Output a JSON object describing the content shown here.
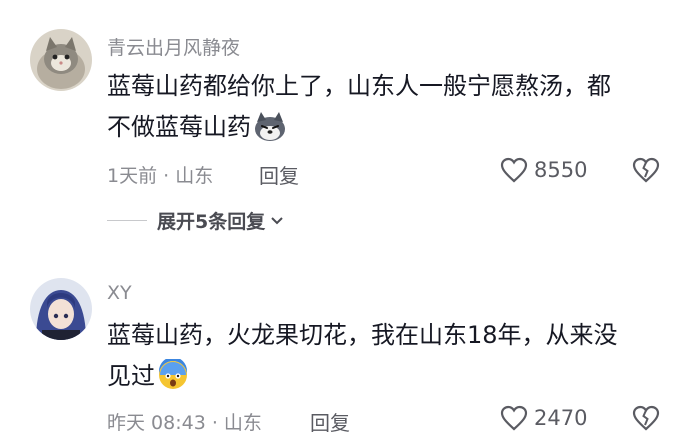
{
  "comments": [
    {
      "username": "青云出月风静夜",
      "text_line1": "蓝莓山药都给你上了，山东人一般宁愿熬汤，都",
      "text_line2": "不做蓝莓山药",
      "emoji_icon": "husky-face-icon",
      "time_location": "1天前 · 山东",
      "reply_label": "回复",
      "like_count": "8550"
    },
    {
      "username": "XY",
      "text_line1": "蓝莓山药，火龙果切花，我在山东18年，从来没",
      "text_line2": "见过",
      "emoji_icon": "scared-face-icon",
      "time_location": "昨天 08:43 · 山东",
      "reply_label": "回复",
      "like_count": "2470"
    }
  ],
  "expand_replies": {
    "label": "展开5条回复"
  },
  "colors": {
    "text": "#161823",
    "secondary": "#8a8b91"
  }
}
